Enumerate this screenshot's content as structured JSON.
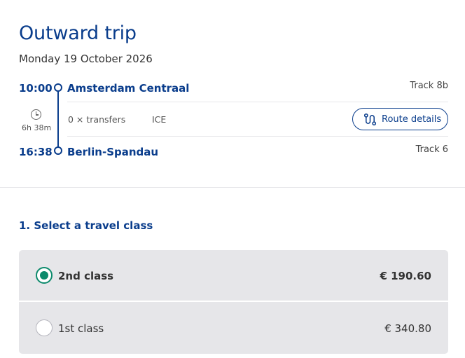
{
  "trip": {
    "title": "Outward trip",
    "date": "Monday 19 October 2026",
    "departure": {
      "time": "10:00",
      "station": "Amsterdam Centraal",
      "track": "Track 8b"
    },
    "arrival": {
      "time": "16:38",
      "station": "Berlin-Spandau",
      "track": "Track 6"
    },
    "duration": "6h 38m",
    "transfers": "0 × transfers",
    "train_type": "ICE",
    "route_details_label": "Route details"
  },
  "travel_class": {
    "heading": "1. Select a travel class",
    "options": [
      {
        "label": "2nd class",
        "price": "€ 190.60",
        "selected": true
      },
      {
        "label": "1st class",
        "price": "€ 340.80",
        "selected": false
      }
    ]
  },
  "colors": {
    "primary": "#0a3d8c",
    "selected_radio": "#0c8a6c",
    "option_bg": "#e6e6e9"
  },
  "icons": {
    "duration": "clock-icon",
    "route_details": "route-icon"
  }
}
